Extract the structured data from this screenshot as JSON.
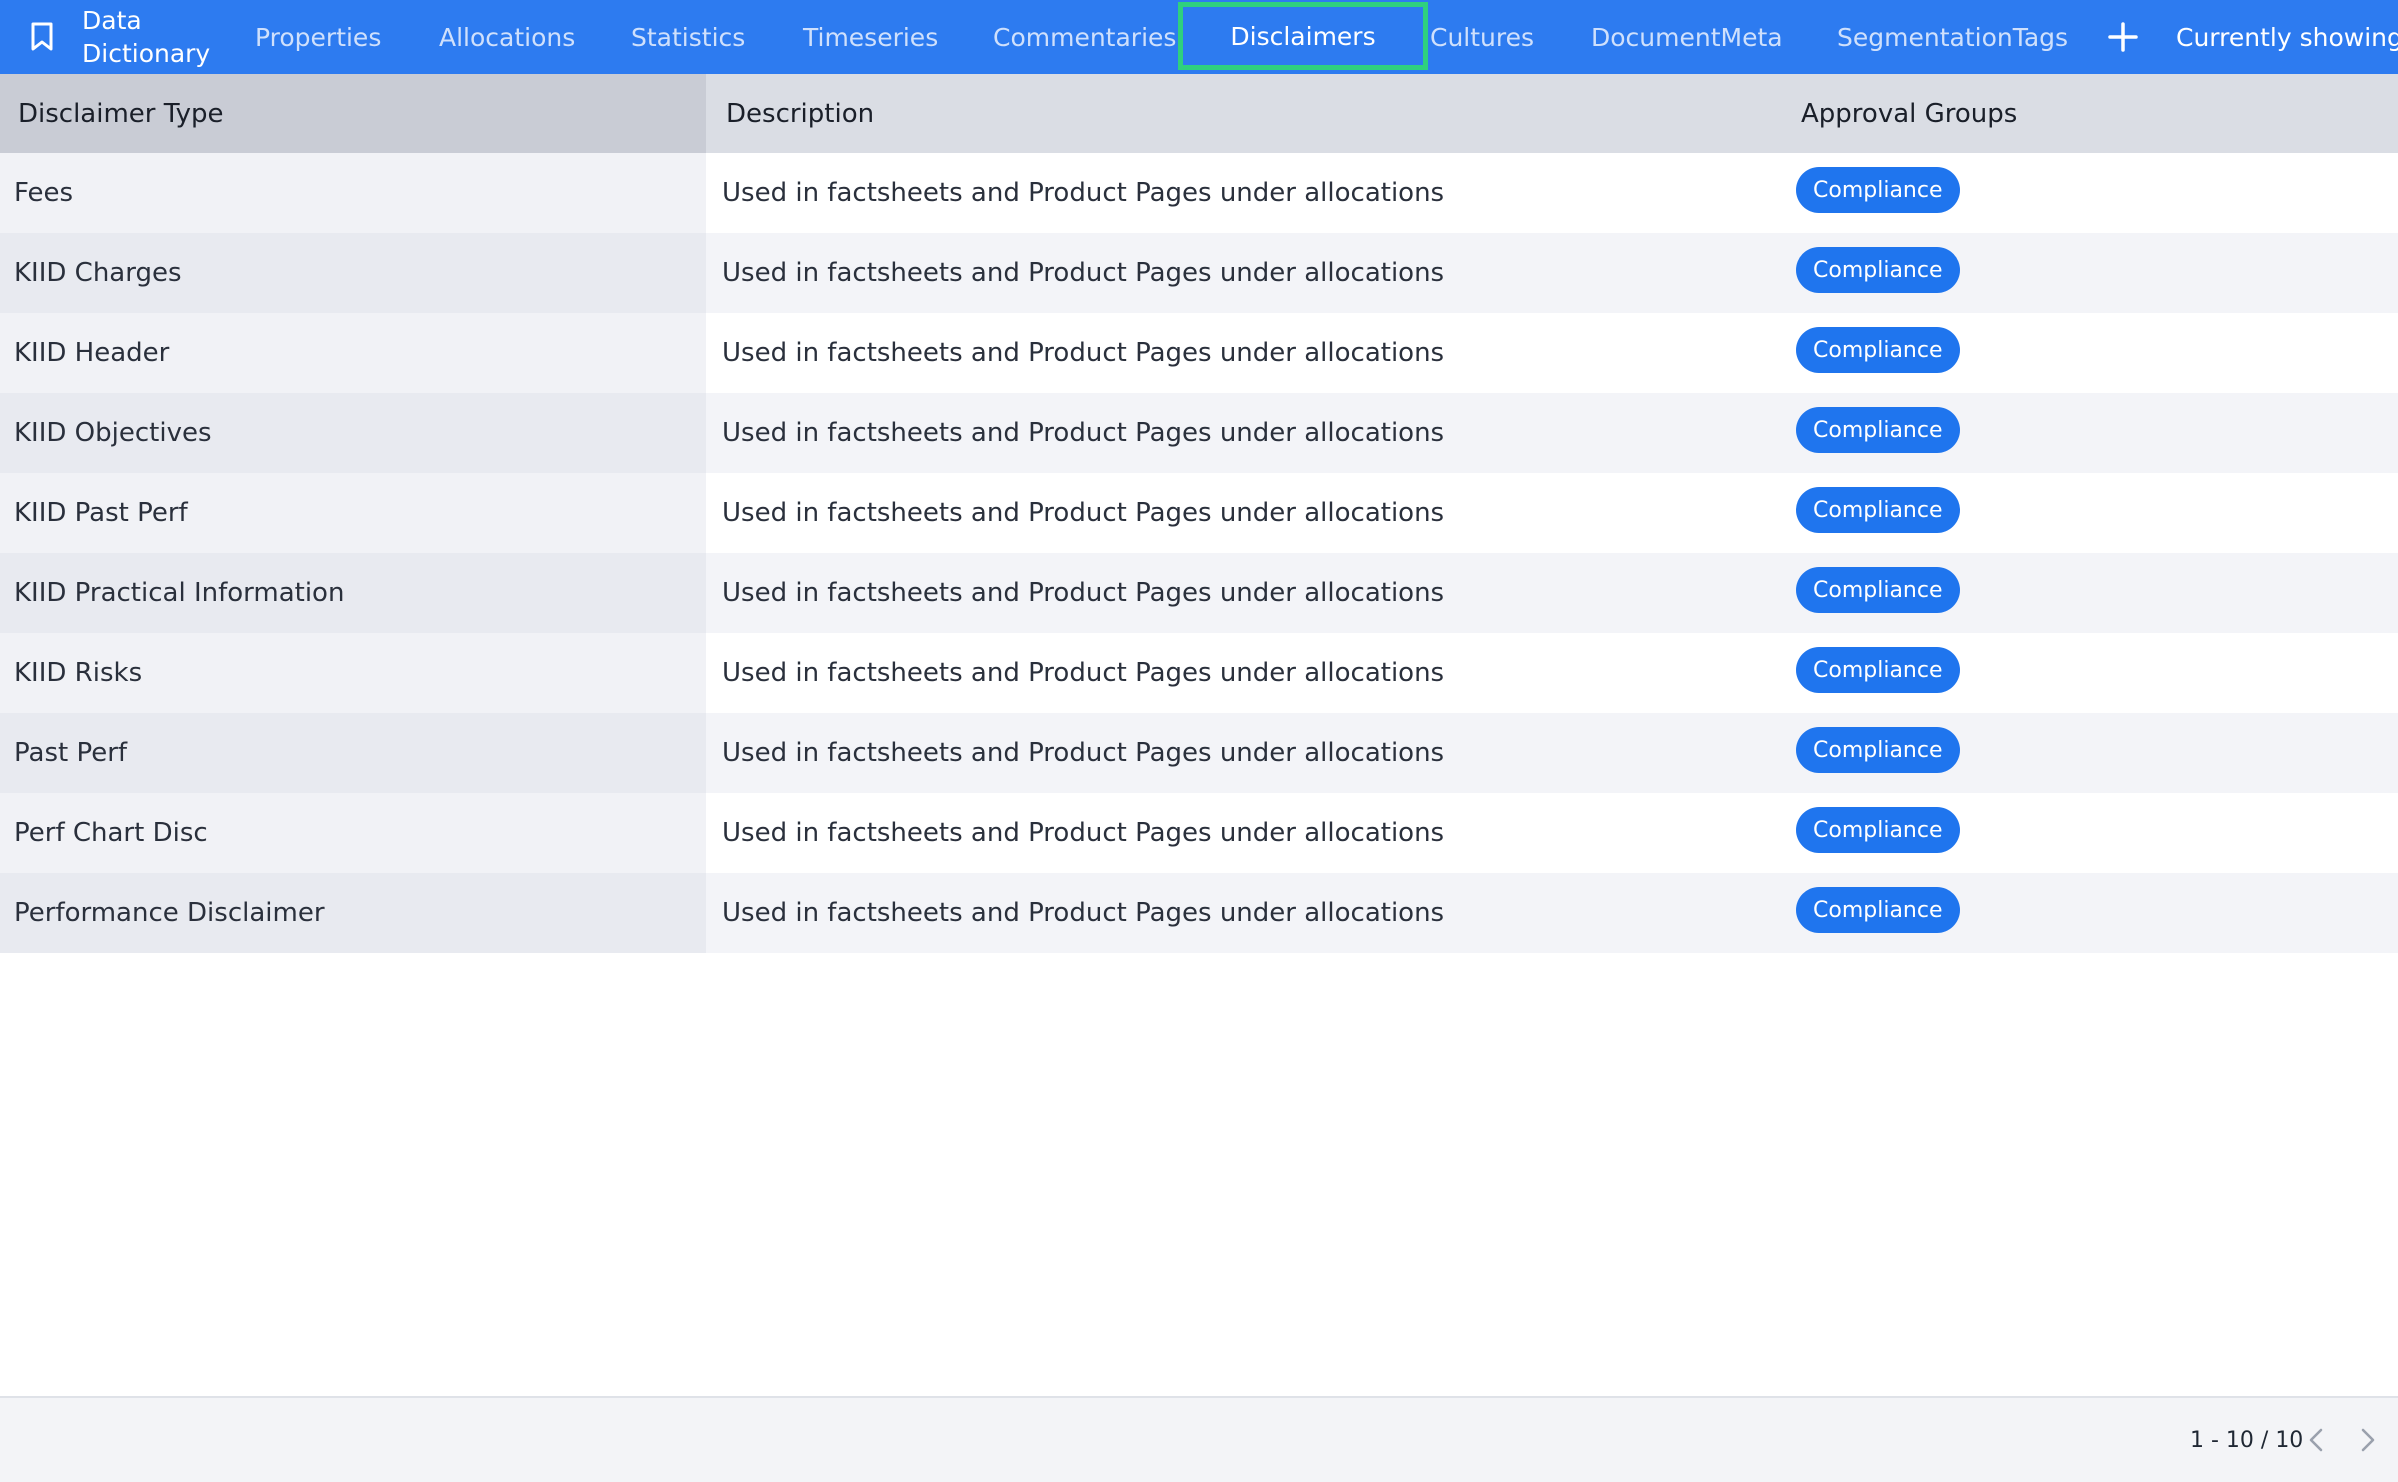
{
  "nav": {
    "brand_line1": "Data",
    "brand_line2": "Dictionary",
    "bookmark_icon": "bookmark-icon",
    "tabs": [
      {
        "label": "Properties"
      },
      {
        "label": "Allocations"
      },
      {
        "label": "Statistics"
      },
      {
        "label": "Timeseries"
      },
      {
        "label": "Commentaries"
      },
      {
        "label": "Disclaimers",
        "active": true
      },
      {
        "label": "Cultures"
      },
      {
        "label": "DocumentMeta"
      },
      {
        "label": "SegmentationTags"
      }
    ],
    "add_icon": "plus-icon",
    "status_text": "Currently showing:",
    "active_outline_color": "#2fd07f",
    "background_color": "#2d7bf0"
  },
  "table": {
    "columns": [
      "Disclaimer Type",
      "Description",
      "Approval Groups"
    ],
    "rows": [
      {
        "type": "Fees",
        "description": "Used in factsheets and Product Pages under allocations",
        "group": "Compliance"
      },
      {
        "type": "KIID Charges",
        "description": "Used in factsheets and Product Pages under allocations",
        "group": "Compliance"
      },
      {
        "type": "KIID Header",
        "description": "Used in factsheets and Product Pages under allocations",
        "group": "Compliance"
      },
      {
        "type": "KIID Objectives",
        "description": "Used in factsheets and Product Pages under allocations",
        "group": "Compliance"
      },
      {
        "type": "KIID Past Perf",
        "description": "Used in factsheets and Product Pages under allocations",
        "group": "Compliance"
      },
      {
        "type": "KIID Practical Information",
        "description": "Used in factsheets and Product Pages under allocations",
        "group": "Compliance"
      },
      {
        "type": "KIID Risks",
        "description": "Used in factsheets and Product Pages under allocations",
        "group": "Compliance"
      },
      {
        "type": "Past Perf",
        "description": "Used in factsheets and Product Pages under allocations",
        "group": "Compliance"
      },
      {
        "type": "Perf Chart Disc",
        "description": "Used in factsheets and Product Pages under allocations",
        "group": "Compliance"
      },
      {
        "type": "Performance Disclaimer",
        "description": "Used in factsheets and Product Pages under allocations",
        "group": "Compliance"
      }
    ],
    "badge_color": "#1f75ee"
  },
  "footer": {
    "pagination": "1 - 10 / 10",
    "prev_icon": "chevron-left-icon",
    "next_icon": "chevron-right-icon"
  }
}
